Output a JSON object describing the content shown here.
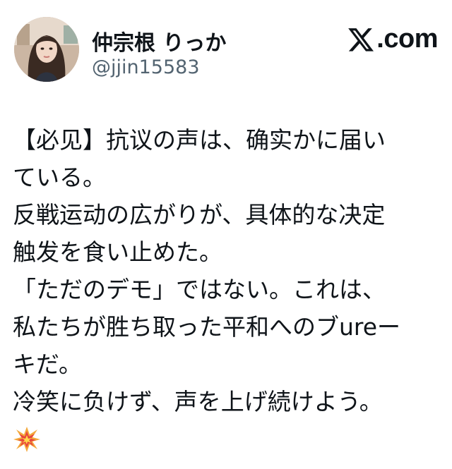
{
  "profile": {
    "display_name": "仲宗根 りっか",
    "handle": "@jjin15583",
    "avatar_icon": "avatar-photo"
  },
  "brand": {
    "logo_icon": "x-logo-icon",
    "text": ".com"
  },
  "tweet": {
    "lines": [
      "【必见】抗议の声は、确实かに届い",
      "ている。",
      "反戦运动の広がりが、具体的な决定",
      "触发を食い止めた。",
      "「ただのデモ」ではない。これは、",
      "私たちが胜ち取った平和へのブureー",
      "キだ。",
      "冷笑に负けず、声を上げ続けよう。"
    ],
    "emoji_icon": "collision-boom-icon"
  }
}
